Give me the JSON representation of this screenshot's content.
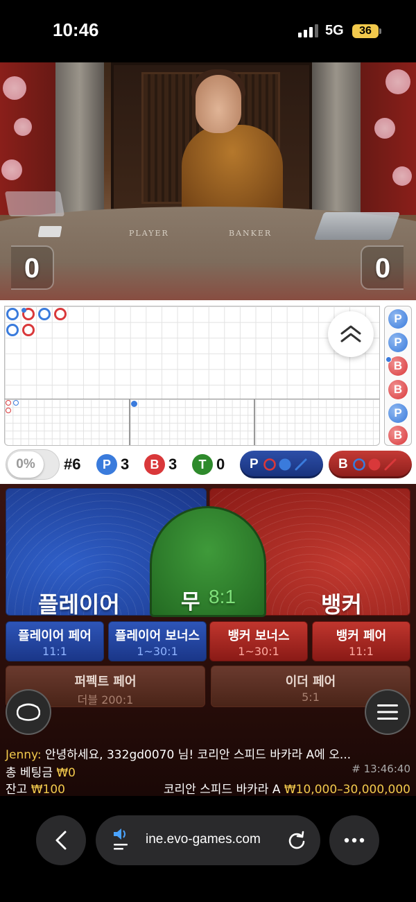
{
  "status_bar": {
    "time": "10:46",
    "network": "5G",
    "battery": "36"
  },
  "video": {
    "table_player_label": "PLAYER",
    "table_banker_label": "BANKER",
    "player_score": "0",
    "banker_score": "0"
  },
  "roadmap": {
    "bead_road": [
      "P",
      "P",
      "B",
      "B",
      "P",
      "B"
    ]
  },
  "stats": {
    "percent": "0%",
    "round": "#6",
    "player_badge": "P",
    "player_count": "3",
    "banker_badge": "B",
    "banker_count": "3",
    "tie_badge": "T",
    "tie_count": "0",
    "player_predict_label": "P",
    "banker_predict_label": "B"
  },
  "bets": {
    "player": "플레이어",
    "tie_label": "무",
    "tie_odds": "8:1",
    "banker": "뱅커",
    "player_pair": "플레이어 페어",
    "player_pair_odds": "11:1",
    "player_bonus": "플레이어 보너스",
    "player_bonus_odds": "1~30:1",
    "banker_bonus": "뱅커 보너스",
    "banker_bonus_odds": "1~30:1",
    "banker_pair": "뱅커 페어",
    "banker_pair_odds": "11:1",
    "perfect_pair": "퍼펙트 페어",
    "perfect_pair_odds": "더블 200:1",
    "either_pair": "이더 페어",
    "either_pair_odds": "5:1"
  },
  "chat": {
    "user": "Jenny:",
    "message": "안녕하세요, 332gd0070 님! 코리안 스피드 바카라 A에 오..."
  },
  "info": {
    "total_bet_label": "총 베팅금",
    "total_bet_value": "₩0",
    "timestamp": "# 13:46:40",
    "balance_label": "잔고",
    "balance_value": "₩100",
    "table_name": "코리안 스피드 바카라 A",
    "limits": "₩10,000–30,000,000"
  },
  "browser": {
    "url": "ine.evo-games.com"
  },
  "colors": {
    "player_blue": "#3a7bdc",
    "banker_red": "#d9383a",
    "tie_green": "#2e8a2c",
    "gold": "#f2c94c"
  }
}
